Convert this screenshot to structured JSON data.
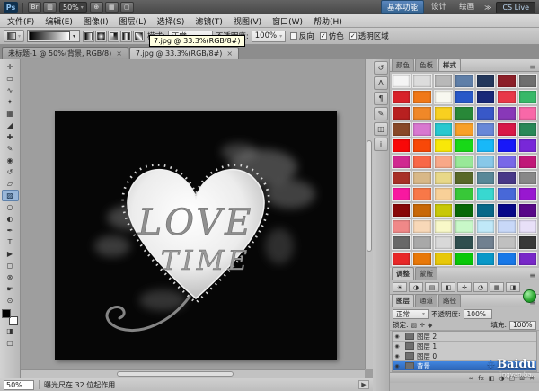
{
  "app": {
    "logo": "Ps"
  },
  "appbar": {
    "buttons_left": [
      {
        "name": "bridge-icon",
        "glyph": "Br"
      },
      {
        "name": "view-extras-icon",
        "glyph": "▥"
      }
    ],
    "zoom_value": "50%",
    "buttons_right": [
      {
        "name": "rotate-view-icon",
        "glyph": "⊕"
      },
      {
        "name": "arrange-documents-icon",
        "glyph": "▦"
      },
      {
        "name": "screen-mode-icon",
        "glyph": "▢"
      }
    ],
    "workspaces": [
      {
        "label": "基本功能",
        "active": true
      },
      {
        "label": "设计"
      },
      {
        "label": "绘画"
      }
    ],
    "overflow": "≫",
    "cs_live": "CS Live"
  },
  "menubar": {
    "items": [
      "文件(F)",
      "编辑(E)",
      "图像(I)",
      "图层(L)",
      "选择(S)",
      "滤镜(T)",
      "视图(V)",
      "窗口(W)",
      "帮助(H)"
    ]
  },
  "options": {
    "gradient_types": [
      {
        "name": "linear-gradient-icon"
      },
      {
        "name": "radial-gradient-icon"
      },
      {
        "name": "angle-gradient-icon"
      },
      {
        "name": "reflected-gradient-icon"
      },
      {
        "name": "diamond-gradient-icon"
      }
    ],
    "mode_label": "模式:",
    "mode_value": "正常",
    "opacity_label": "不透明度:",
    "opacity_value": "100%",
    "checks": [
      {
        "label": "反向",
        "checked": false
      },
      {
        "label": "仿色",
        "checked": true
      },
      {
        "label": "透明区域",
        "checked": true
      }
    ],
    "tooltip": "7.jpg @ 33.3%(RGB/8#)"
  },
  "doc_tabs": [
    {
      "label": "未标题-1 @ 50%(背景, RGB/8)"
    },
    {
      "label": "7.jpg @ 33.3%(RGB/8#)",
      "active": true
    }
  ],
  "toolbar": {
    "tools": [
      {
        "name": "move-tool",
        "glyph": "✛"
      },
      {
        "name": "marquee-tool",
        "glyph": "▭"
      },
      {
        "name": "lasso-tool",
        "glyph": "∿"
      },
      {
        "name": "quick-selection-tool",
        "glyph": "✦"
      },
      {
        "name": "crop-tool",
        "glyph": "▦"
      },
      {
        "name": "eyedropper-tool",
        "glyph": "◢"
      },
      {
        "name": "healing-brush-tool",
        "glyph": "✚"
      },
      {
        "name": "brush-tool",
        "glyph": "✎"
      },
      {
        "name": "clone-stamp-tool",
        "glyph": "◉"
      },
      {
        "name": "history-brush-tool",
        "glyph": "↺"
      },
      {
        "name": "eraser-tool",
        "glyph": "▱"
      },
      {
        "name": "gradient-tool",
        "glyph": "▨",
        "active": true
      },
      {
        "name": "blur-tool",
        "glyph": "○"
      },
      {
        "name": "dodge-tool",
        "glyph": "◐"
      },
      {
        "name": "pen-tool",
        "glyph": "✒"
      },
      {
        "name": "type-tool",
        "glyph": "T"
      },
      {
        "name": "path-selection-tool",
        "glyph": "▶"
      },
      {
        "name": "shape-tool",
        "glyph": "◻"
      },
      {
        "name": "rotate-canvas-tool",
        "glyph": "⊗"
      },
      {
        "name": "hand-tool",
        "glyph": "☛"
      },
      {
        "name": "zoom-tool",
        "glyph": "⊙"
      }
    ]
  },
  "canvas": {
    "word1": "LOVE",
    "word2": "TIME"
  },
  "dock": {
    "strip_icons": [
      {
        "name": "history-panel-icon",
        "glyph": "↺"
      },
      {
        "name": "character-panel-icon",
        "glyph": "A"
      },
      {
        "name": "paragraph-panel-icon",
        "glyph": "¶"
      },
      {
        "name": "brush-panel-icon",
        "glyph": "✎"
      },
      {
        "name": "clone-source-panel-icon",
        "glyph": "◫"
      },
      {
        "name": "info-panel-icon",
        "glyph": "i"
      }
    ],
    "styles": {
      "tabs": [
        "颜色",
        "色板",
        "样式"
      ],
      "active_tab": "样式",
      "swatches": [
        "#f4f4f4",
        "#dcdcdc",
        "#b8b8b8",
        "#5f7fa8",
        "#24385c",
        "#8c1f28",
        "#6f6f6f",
        "#d8222a",
        "#f07818",
        "#f8f8f0",
        "#2858c8",
        "#182878",
        "#e83848",
        "#38b868",
        "#b82020",
        "#f08828",
        "#f8d020",
        "#288838",
        "#3858c8",
        "#8838b8",
        "#f868a8",
        "#884828",
        "#d878d0",
        "#28c8d0",
        "#f8a028",
        "#6888d8",
        "#d81848",
        "#288858",
        "#f80808",
        "#f84808",
        "#f8e808",
        "#18d818",
        "#18b8f8",
        "#1818f8",
        "#7828d8",
        "#d02890",
        "#f86848",
        "#f8a888",
        "#98e898",
        "#88c8e8",
        "#7868e8",
        "#c01878",
        "#a83028",
        "#d8b888",
        "#e8d888",
        "#586828",
        "#588898",
        "#483888",
        "#888888",
        "#f818a0",
        "#f87848",
        "#f8d098",
        "#38c838",
        "#38d8d0",
        "#4868d8",
        "#9818d0",
        "#880808",
        "#c86808",
        "#c8c808",
        "#086808",
        "#086888",
        "#080888",
        "#580888",
        "#f08888",
        "#f8d8b8",
        "#f8f8c8",
        "#c8f8c8",
        "#c0e8f8",
        "#c8d8f8",
        "#e8e0f8",
        "#686868",
        "#a8a8a8",
        "#d8d8d8",
        "#2f4f4f",
        "#708090",
        "#c0c0c0",
        "#383838",
        "#e82828",
        "#e87808",
        "#e8c808",
        "#08c808",
        "#0898c8",
        "#1878e8",
        "#7828c8"
      ]
    },
    "adjustments": {
      "tabs": [
        "调整",
        "蒙版"
      ],
      "tiles": [
        "☀",
        "◑",
        "▤",
        "◧",
        "✛",
        "◔",
        "▦",
        "◨"
      ]
    },
    "layers": {
      "tabs": [
        "图层",
        "通道",
        "路径"
      ],
      "blend_mode": "正常",
      "opacity_label": "不透明度:",
      "opacity_value": "100%",
      "lock_label": "锁定:",
      "lock_icons": [
        "▨",
        "✛",
        "◆"
      ],
      "fill_label": "填充:",
      "fill_value": "100%",
      "items": [
        {
          "name": "图层 2"
        },
        {
          "name": "图层 1"
        },
        {
          "name": "图层 0"
        },
        {
          "name": "背景",
          "selected": true
        }
      ],
      "bottom_icons": [
        {
          "name": "link-layers-icon",
          "glyph": "∞"
        },
        {
          "name": "layer-style-icon",
          "glyph": "fx"
        },
        {
          "name": "layer-mask-icon",
          "glyph": "◧"
        },
        {
          "name": "adjustment-layer-icon",
          "glyph": "◑"
        },
        {
          "name": "layer-group-icon",
          "glyph": "▢"
        },
        {
          "name": "new-layer-icon",
          "glyph": "⊞"
        },
        {
          "name": "delete-layer-icon",
          "glyph": "✕"
        }
      ]
    }
  },
  "statusbar": {
    "zoom": "50%",
    "message": "曝光尺在 32 位起作用"
  },
  "watermark": {
    "brand": "Baidu",
    "sub": "jingyan.ba.."
  },
  "icons": {
    "dropdown": "▾",
    "close": "×",
    "check": "✓",
    "panel_menu": "≡",
    "eye": "◉",
    "paw": "❉",
    "scroll_right": "▶",
    "quick_mask": "◨",
    "screen_mode": "▢"
  }
}
